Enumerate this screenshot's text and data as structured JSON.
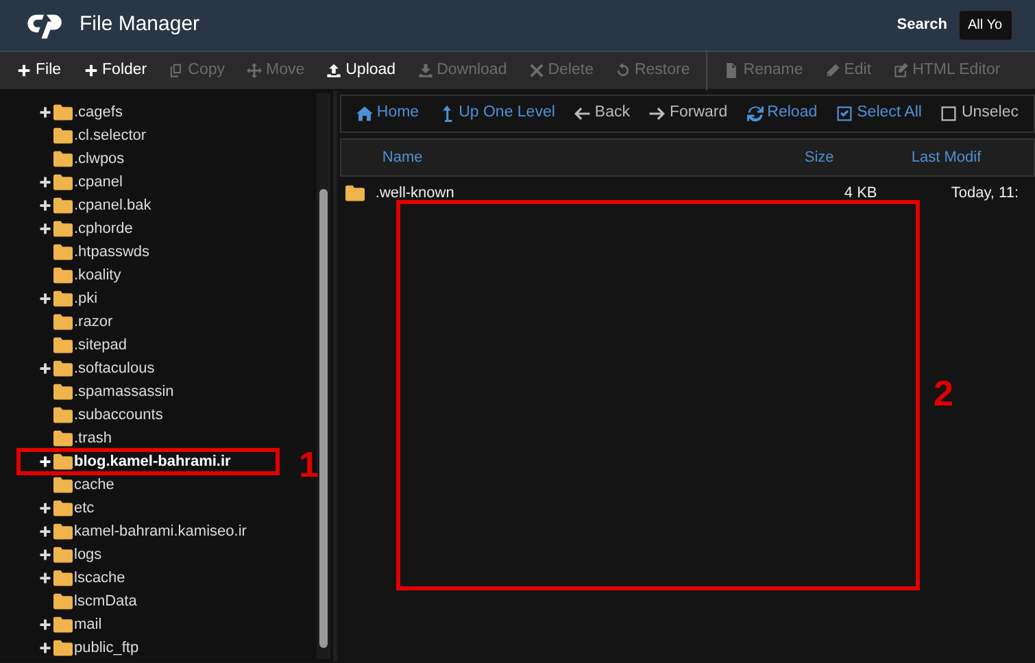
{
  "header": {
    "title": "File Manager",
    "search_label": "Search",
    "search_scope": "All Yo"
  },
  "toolbar": [
    {
      "label": "File",
      "kind": "plus",
      "disabled": false
    },
    {
      "label": "Folder",
      "kind": "plus",
      "disabled": false
    },
    {
      "label": "Copy",
      "kind": "copy",
      "disabled": true
    },
    {
      "label": "Move",
      "kind": "move",
      "disabled": true
    },
    {
      "label": "Upload",
      "kind": "upload",
      "disabled": false
    },
    {
      "label": "Download",
      "kind": "download",
      "disabled": true
    },
    {
      "label": "Delete",
      "kind": "delete",
      "disabled": true
    },
    {
      "label": "Restore",
      "kind": "restore",
      "disabled": true
    },
    {
      "label": "Rename",
      "kind": "rename",
      "disabled": true
    },
    {
      "label": "Edit",
      "kind": "edit",
      "disabled": true
    },
    {
      "label": "HTML Editor",
      "kind": "html",
      "disabled": true
    }
  ],
  "tree": [
    {
      "name": ".cagefs",
      "expandable": true,
      "selected": false
    },
    {
      "name": ".cl.selector",
      "expandable": false,
      "selected": false
    },
    {
      "name": ".clwpos",
      "expandable": false,
      "selected": false
    },
    {
      "name": ".cpanel",
      "expandable": true,
      "selected": false
    },
    {
      "name": ".cpanel.bak",
      "expandable": true,
      "selected": false
    },
    {
      "name": ".cphorde",
      "expandable": true,
      "selected": false
    },
    {
      "name": ".htpasswds",
      "expandable": false,
      "selected": false
    },
    {
      "name": ".koality",
      "expandable": false,
      "selected": false
    },
    {
      "name": ".pki",
      "expandable": true,
      "selected": false
    },
    {
      "name": ".razor",
      "expandable": false,
      "selected": false
    },
    {
      "name": ".sitepad",
      "expandable": false,
      "selected": false
    },
    {
      "name": ".softaculous",
      "expandable": true,
      "selected": false
    },
    {
      "name": ".spamassassin",
      "expandable": false,
      "selected": false
    },
    {
      "name": ".subaccounts",
      "expandable": false,
      "selected": false
    },
    {
      "name": ".trash",
      "expandable": false,
      "selected": false
    },
    {
      "name": "blog.kamel-bahrami.ir",
      "expandable": true,
      "selected": true
    },
    {
      "name": "cache",
      "expandable": false,
      "selected": false
    },
    {
      "name": "etc",
      "expandable": true,
      "selected": false
    },
    {
      "name": "kamel-bahrami.kamiseo.ir",
      "expandable": true,
      "selected": false
    },
    {
      "name": "logs",
      "expandable": true,
      "selected": false
    },
    {
      "name": "lscache",
      "expandable": true,
      "selected": false
    },
    {
      "name": "lscmData",
      "expandable": false,
      "selected": false
    },
    {
      "name": "mail",
      "expandable": true,
      "selected": false
    },
    {
      "name": "public_ftp",
      "expandable": true,
      "selected": false
    }
  ],
  "navbar": [
    {
      "label": "Home",
      "kind": "home",
      "disabled": false
    },
    {
      "label": "Up One Level",
      "kind": "up",
      "disabled": false
    },
    {
      "label": "Back",
      "kind": "back",
      "disabled": true
    },
    {
      "label": "Forward",
      "kind": "forward",
      "disabled": true
    },
    {
      "label": "Reload",
      "kind": "reload",
      "disabled": false
    },
    {
      "label": "Select All",
      "kind": "selectall",
      "disabled": false
    },
    {
      "label": "Unselec",
      "kind": "unselect",
      "disabled": true
    }
  ],
  "table": {
    "columns": [
      "Name",
      "Size",
      "Last Modif"
    ],
    "rows": [
      {
        "name": ".well-known",
        "size": "4 KB",
        "modified": "Today, 11:"
      }
    ]
  },
  "annotations": [
    {
      "number": "1"
    },
    {
      "number": "2"
    }
  ]
}
